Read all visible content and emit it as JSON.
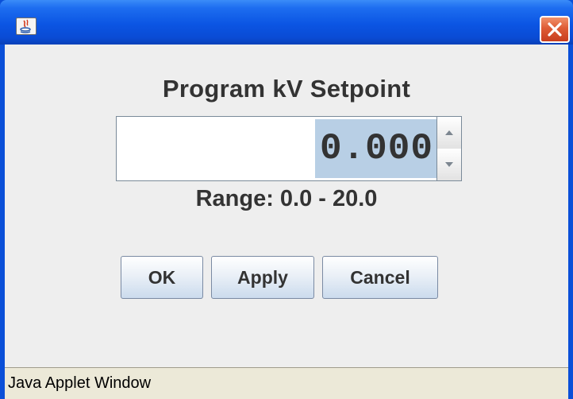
{
  "window": {
    "icon": "java-icon",
    "close_icon": "close-icon"
  },
  "dialog": {
    "title": "Program kV Setpoint",
    "spinner_value": "0.000",
    "range_label": "Range: 0.0 - 20.0"
  },
  "buttons": {
    "ok": "OK",
    "apply": "Apply",
    "cancel": "Cancel"
  },
  "status": {
    "text": "Java Applet Window"
  },
  "colors": {
    "titlebar": "#0a4fd8",
    "close_button": "#de5c35",
    "selection": "#b8cfe5",
    "background": "#eeeeee"
  }
}
